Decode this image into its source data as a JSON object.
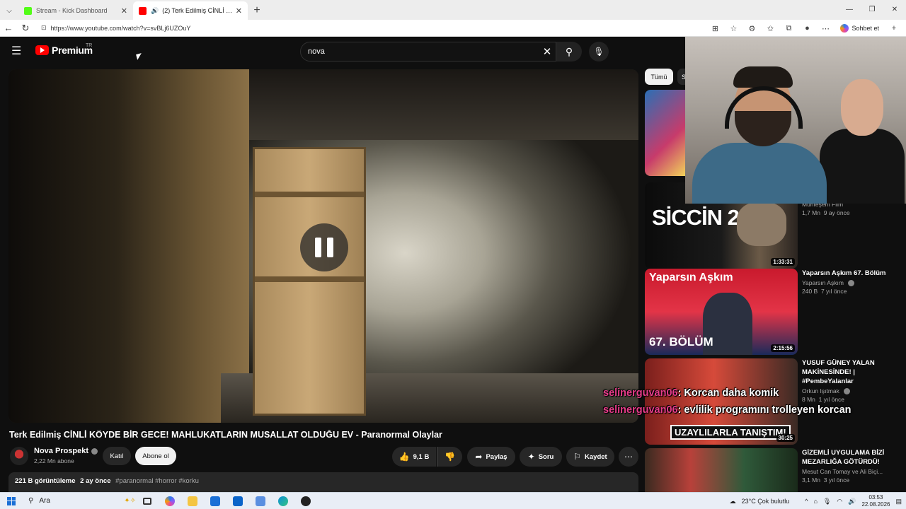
{
  "browser": {
    "tabs": [
      {
        "title": "Stream - Kick Dashboard",
        "active": false,
        "favicon_color": "#53fc18"
      },
      {
        "title": "(2) Terk Edilmiş CİNLİ KÖYDE BİR GECE!",
        "active": true,
        "favicon_color": "#ff0000"
      }
    ],
    "url": "https://www.youtube.com/watch?v=svBLj6UZOuY",
    "copilot_label": "Sohbet et"
  },
  "youtube": {
    "logo_text": "Premium",
    "region": "TR",
    "search_query": "nova",
    "video": {
      "title": "Terk Edilmiş CİNLİ KÖYDE BİR GECE! MAHLUKATLARIN MUSALLAT OLDUĞU EV - Paranormal Olaylar",
      "channel": "Nova Prospekt",
      "subscribers": "2,22 Mn abone",
      "join_label": "Katıl",
      "subscribe_label": "Abone ol",
      "likes": "9,1 B",
      "share_label": "Paylaş",
      "ask_label": "Soru",
      "save_label": "Kaydet",
      "views": "221 B görüntüleme",
      "date": "2 ay önce",
      "tags": "#paranormal #horror #korku"
    },
    "chips": [
      "Tümü",
      "S"
    ],
    "recommendations": [
      {
        "title": "",
        "channel": "Muhteşem Film",
        "views": "1,7 Mn",
        "age": "9 ay önce",
        "duration": "1:33:31",
        "thumb_text": "SİCCİN 2"
      },
      {
        "title": "Yaparsın Aşkım 67. Bölüm",
        "channel": "Yaparsın Aşkım",
        "views": "240 B",
        "age": "7 yıl önce",
        "duration": "2:15:56",
        "thumb_text": "Yaparsın Aşkım",
        "thumb_text2": "67. BÖLÜM"
      },
      {
        "title": "YUSUF GÜNEY YALAN MAKİNESİNDE! | #PembeYalanlar",
        "channel": "Orkun Işıtmak",
        "views": "8 Mn",
        "age": "1 yıl önce",
        "duration": "30:25",
        "thumb_text": "UZAYLILARLA TANIŞTIM!"
      },
      {
        "title": "GİZEMLİ UYGULAMA BİZİ MEZARLIĞA GÖTÜRDÜ!",
        "channel": "Mesut Can Tomay ve Ali Biçi...",
        "views": "3,1 Mn",
        "age": "3 yıl önce",
        "duration": "",
        "thumb_text": ""
      }
    ]
  },
  "chat": [
    {
      "user": "selinerguvan06",
      "message": ": Korcan daha komik"
    },
    {
      "user": "selinerguvan06",
      "message": ": evlilik programını trolleyen korcan"
    }
  ],
  "taskbar": {
    "search_label": "Ara",
    "weather": "23°C  Çok bulutlu",
    "time": "03:53",
    "date": "22.08.2026"
  }
}
